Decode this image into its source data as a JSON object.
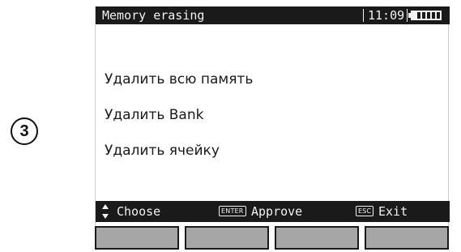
{
  "step": "3",
  "title_bar": {
    "title": "Memory erasing",
    "clock": "11:09"
  },
  "menu": {
    "items": [
      {
        "label": "Удалить всю память"
      },
      {
        "label": "Удалить Bank"
      },
      {
        "label": "Удалить ячейку"
      }
    ]
  },
  "status_bar": {
    "choose_label": "Choose",
    "enter_key": "ENTER",
    "approve_label": "Approve",
    "esc_key": "ESC",
    "exit_label": "Exit"
  },
  "softkeys": {
    "count": 4
  },
  "icons": {
    "battery": "battery-full-icon",
    "choose_arrows": "up-down-arrows-icon"
  },
  "colors": {
    "bar_background": "#1a1a1a",
    "bar_text": "#f2f2f2",
    "softkey_fill": "#a6a6a6"
  }
}
